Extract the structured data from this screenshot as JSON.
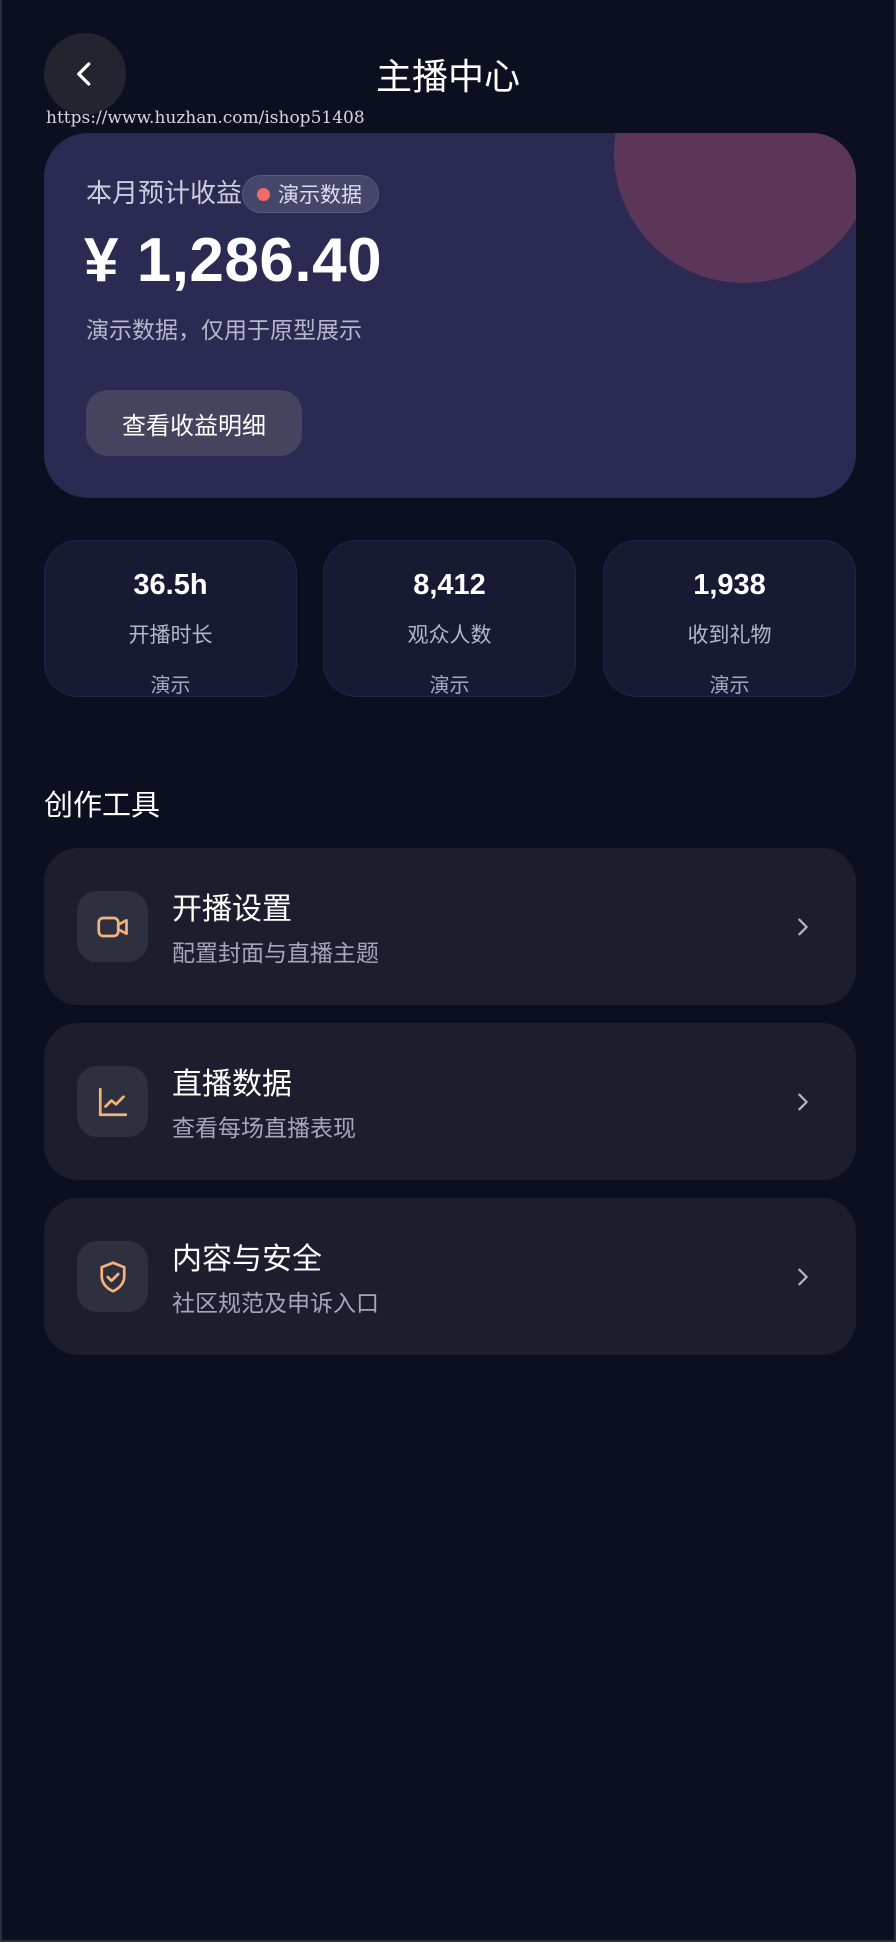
{
  "header": {
    "title": "主播中心",
    "watermark": "https://www.huzhan.com/ishop51408"
  },
  "earnings": {
    "label": "本月预计收益",
    "badge": "演示数据",
    "amount": "¥ 1,286.40",
    "note": "演示数据，仅用于原型展示",
    "detail_button": "查看收益明细"
  },
  "stats": [
    {
      "value": "36.5h",
      "label": "开播时长",
      "tag": "演示"
    },
    {
      "value": "8,412",
      "label": "观众人数",
      "tag": "演示"
    },
    {
      "value": "1,938",
      "label": "收到礼物",
      "tag": "演示"
    }
  ],
  "tools": {
    "section_title": "创作工具",
    "items": [
      {
        "title": "开播设置",
        "subtitle": "配置封面与直播主题",
        "icon": "video-camera-icon"
      },
      {
        "title": "直播数据",
        "subtitle": "查看每场直播表现",
        "icon": "line-chart-icon"
      },
      {
        "title": "内容与安全",
        "subtitle": "社区规范及申诉入口",
        "icon": "shield-check-icon"
      }
    ]
  },
  "colors": {
    "background": "#0c0f1f",
    "earnings_card": "#2b2a52",
    "accent_icon": "#f6b27a",
    "badge_dot": "#f26a6a"
  }
}
